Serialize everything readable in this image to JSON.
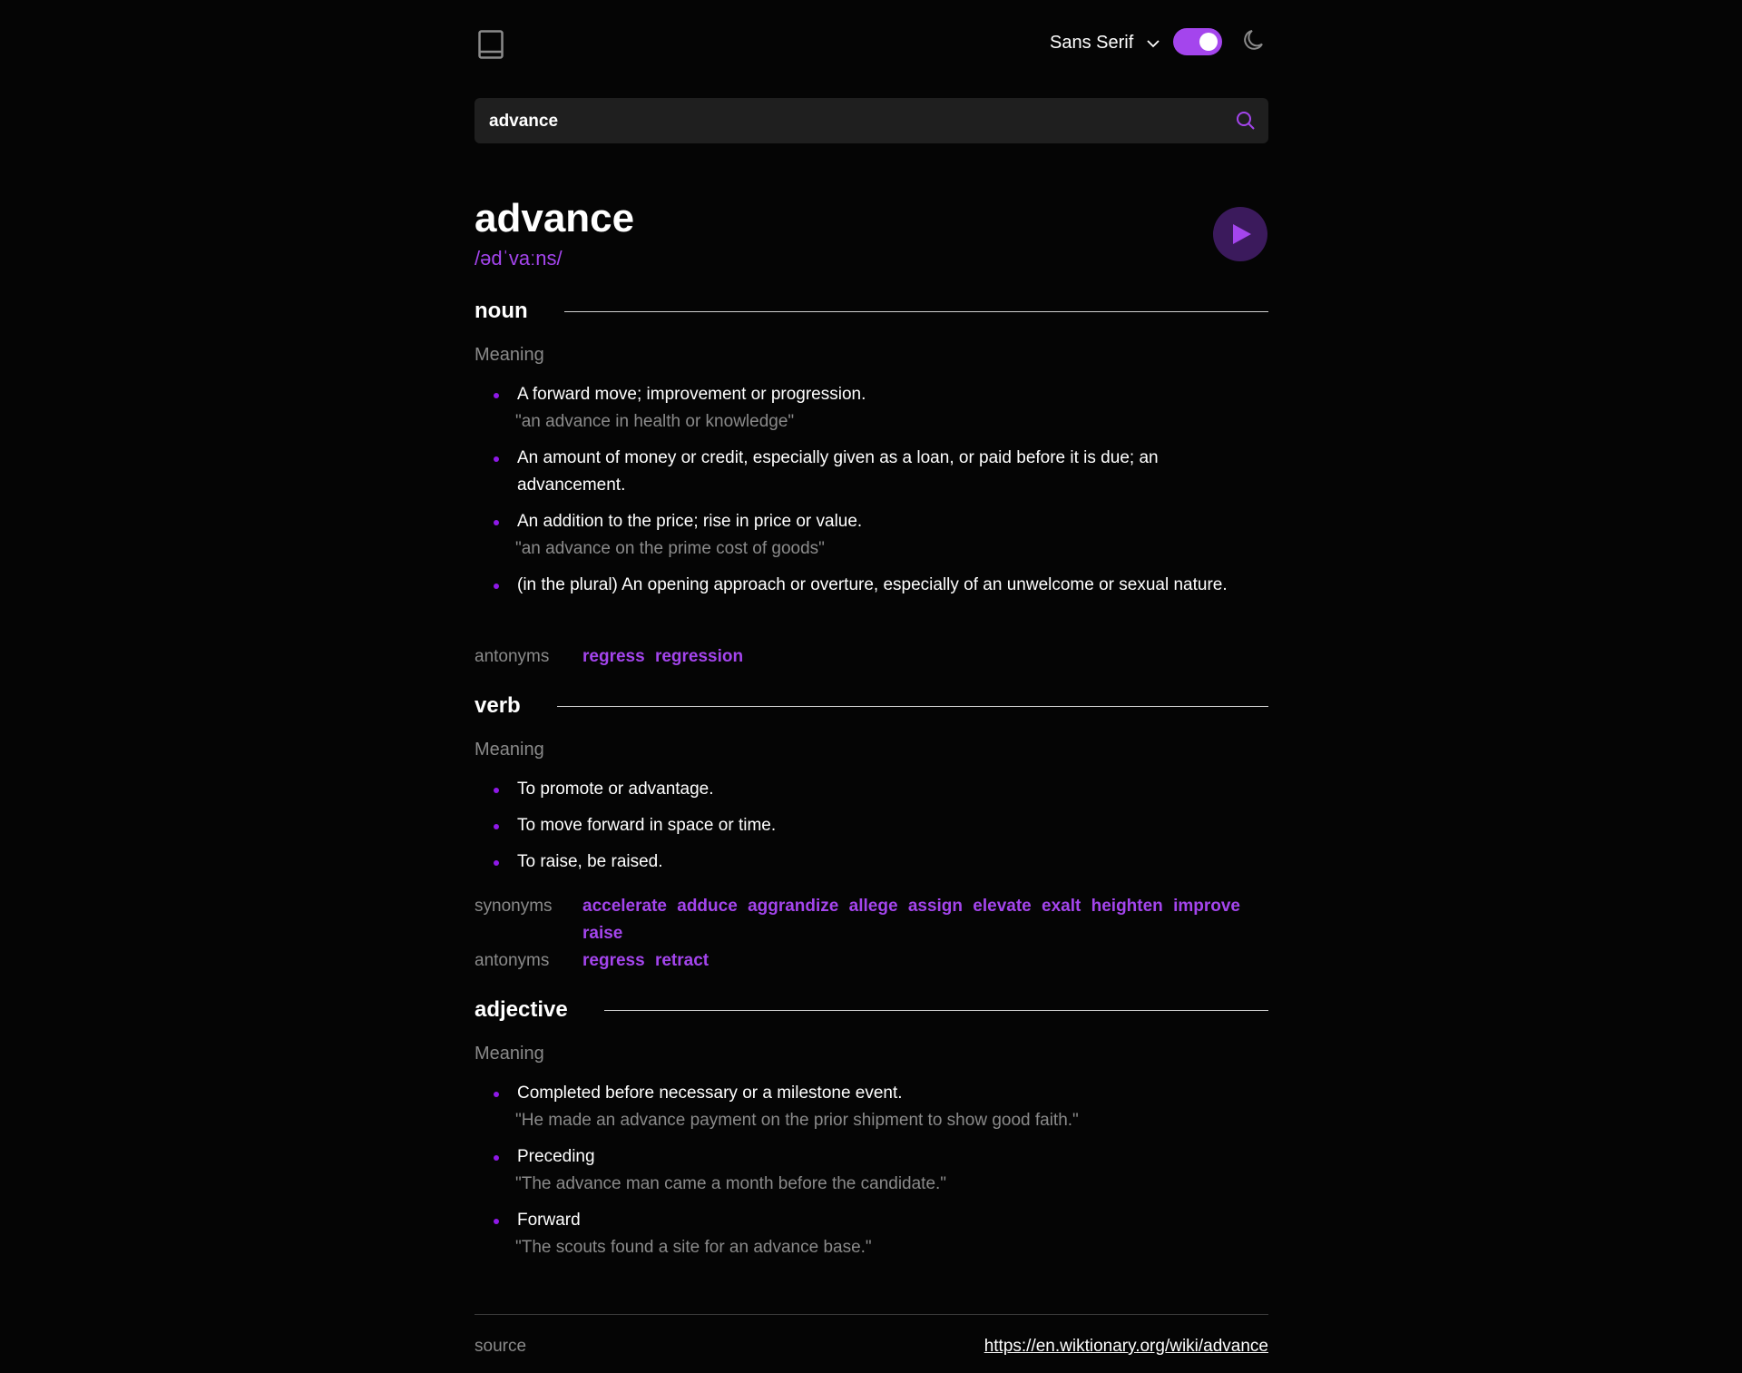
{
  "header": {
    "logo_icon": "book-icon",
    "font_select": "Sans Serif",
    "theme_toggle_on": true,
    "theme_icon": "moon-icon"
  },
  "search": {
    "value": "advance",
    "icon": "search-icon"
  },
  "entry": {
    "word": "advance",
    "phonetic": "/ədˈvaːns/",
    "play_icon": "play-icon",
    "accent_color": "#a445ed"
  },
  "meanings": [
    {
      "part_of_speech": "noun",
      "meaning_label": "Meaning",
      "definitions": [
        {
          "text": "A forward move; improvement or progression.",
          "example": "\"an advance in health or knowledge\""
        },
        {
          "text": "An amount of money or credit, especially given as a loan, or paid before it is due; an advancement.",
          "example": ""
        },
        {
          "text": "An addition to the price; rise in price or value.",
          "example": "\"an advance on the prime cost of goods\""
        },
        {
          "text": "(in the plural) An opening approach or overture, especially of an unwelcome or sexual nature.",
          "example": ""
        }
      ],
      "antonyms_label": "antonyms",
      "antonyms": [
        "regress",
        "regression"
      ]
    },
    {
      "part_of_speech": "verb",
      "meaning_label": "Meaning",
      "definitions": [
        {
          "text": "To promote or advantage.",
          "example": ""
        },
        {
          "text": "To move forward in space or time.",
          "example": ""
        },
        {
          "text": "To raise, be raised.",
          "example": ""
        }
      ],
      "synonyms_label": "synonyms",
      "synonyms": [
        "accelerate",
        "adduce",
        "aggrandize",
        "allege",
        "assign",
        "elevate",
        "exalt",
        "heighten",
        "improve",
        "raise"
      ],
      "antonyms_label": "antonyms",
      "antonyms": [
        "regress",
        "retract"
      ]
    },
    {
      "part_of_speech": "adjective",
      "meaning_label": "Meaning",
      "definitions": [
        {
          "text": "Completed before necessary or a milestone event.",
          "example": "\"He made an advance payment on the prior shipment to show good faith.\""
        },
        {
          "text": "Preceding",
          "example": "\"The advance man came a month before the candidate.\""
        },
        {
          "text": "Forward",
          "example": "\"The scouts found a site for an advance base.\""
        }
      ]
    }
  ],
  "footer": {
    "source_label": "source",
    "source_url": "https://en.wiktionary.org/wiki/advance"
  }
}
